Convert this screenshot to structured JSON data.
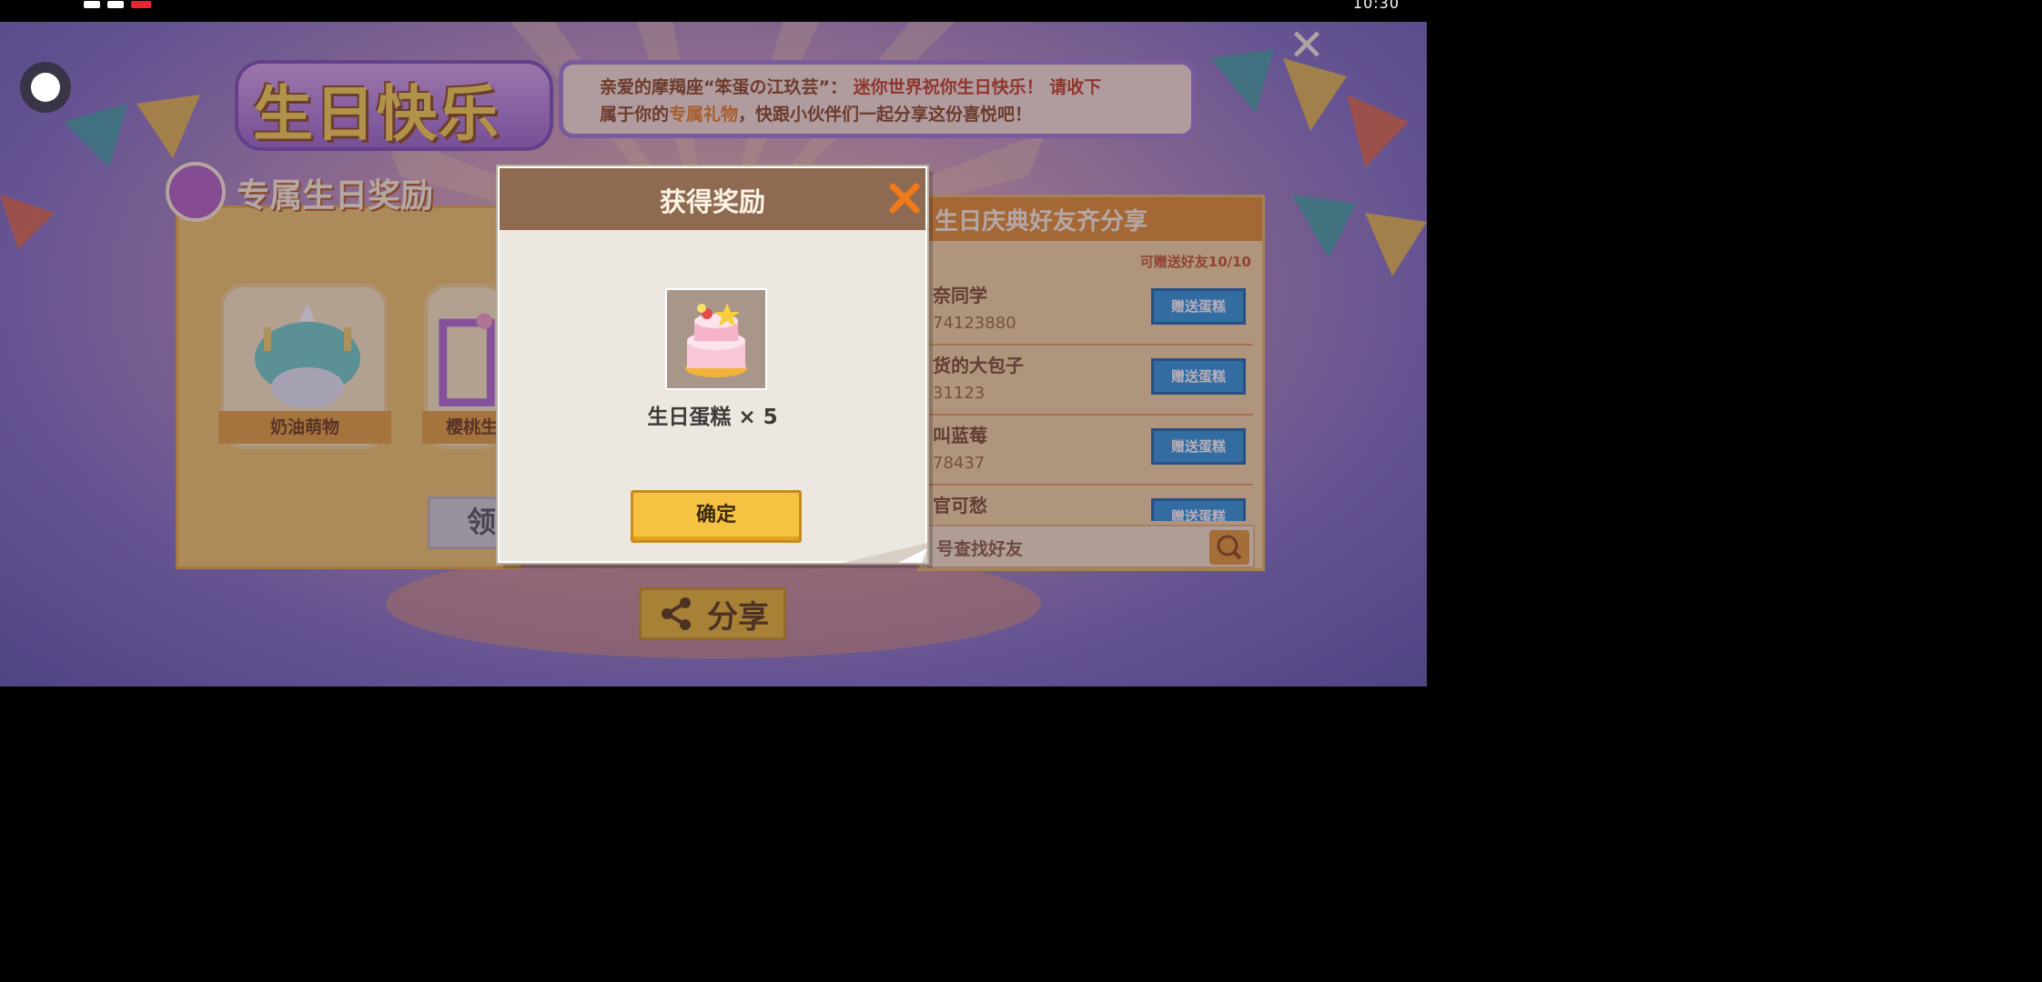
{
  "status_bar": {
    "time": "10:30"
  },
  "scene": {
    "close_glyph": "✕",
    "title": "生日快乐",
    "message": {
      "line1_prefix": "亲爱的摩羯座",
      "line1_name": "“笨蛋の江玖芸”",
      "line1_sep": "：",
      "line1_strong": "迷你世界祝你生日快乐！ 请收下",
      "line2_prefix": "属于你的",
      "line2_hl": "专属礼物",
      "line2_rest": "，快跟小伙伴们一起分享这份喜悦吧！"
    },
    "reward_panel": {
      "header": "专属生日奖励",
      "cards": [
        {
          "name": "奶油萌物"
        },
        {
          "name": "樱桃生"
        }
      ],
      "claim_label": "领"
    },
    "friends_panel": {
      "header": "生日庆典好友齐分享",
      "quota": "可赠送好友10/10",
      "give_label": "赠送蛋糕",
      "friends": [
        {
          "name": "奈同学",
          "id": "74123880"
        },
        {
          "name": "货的大包子",
          "id": "31123"
        },
        {
          "name": "叫蓝莓",
          "id": "78437"
        },
        {
          "name": "官可愁",
          "id": ""
        }
      ],
      "search_placeholder": "号查找好友"
    },
    "share_label": "分享"
  },
  "modal": {
    "title": "获得奖励",
    "item_name": "生日蛋糕 × 5",
    "confirm_label": "确定"
  },
  "colors": {
    "accent_orange": "#e9801a",
    "modal_header": "#8f6a52",
    "confirm_yellow": "#f5c242",
    "give_blue": "#2c96d9"
  }
}
